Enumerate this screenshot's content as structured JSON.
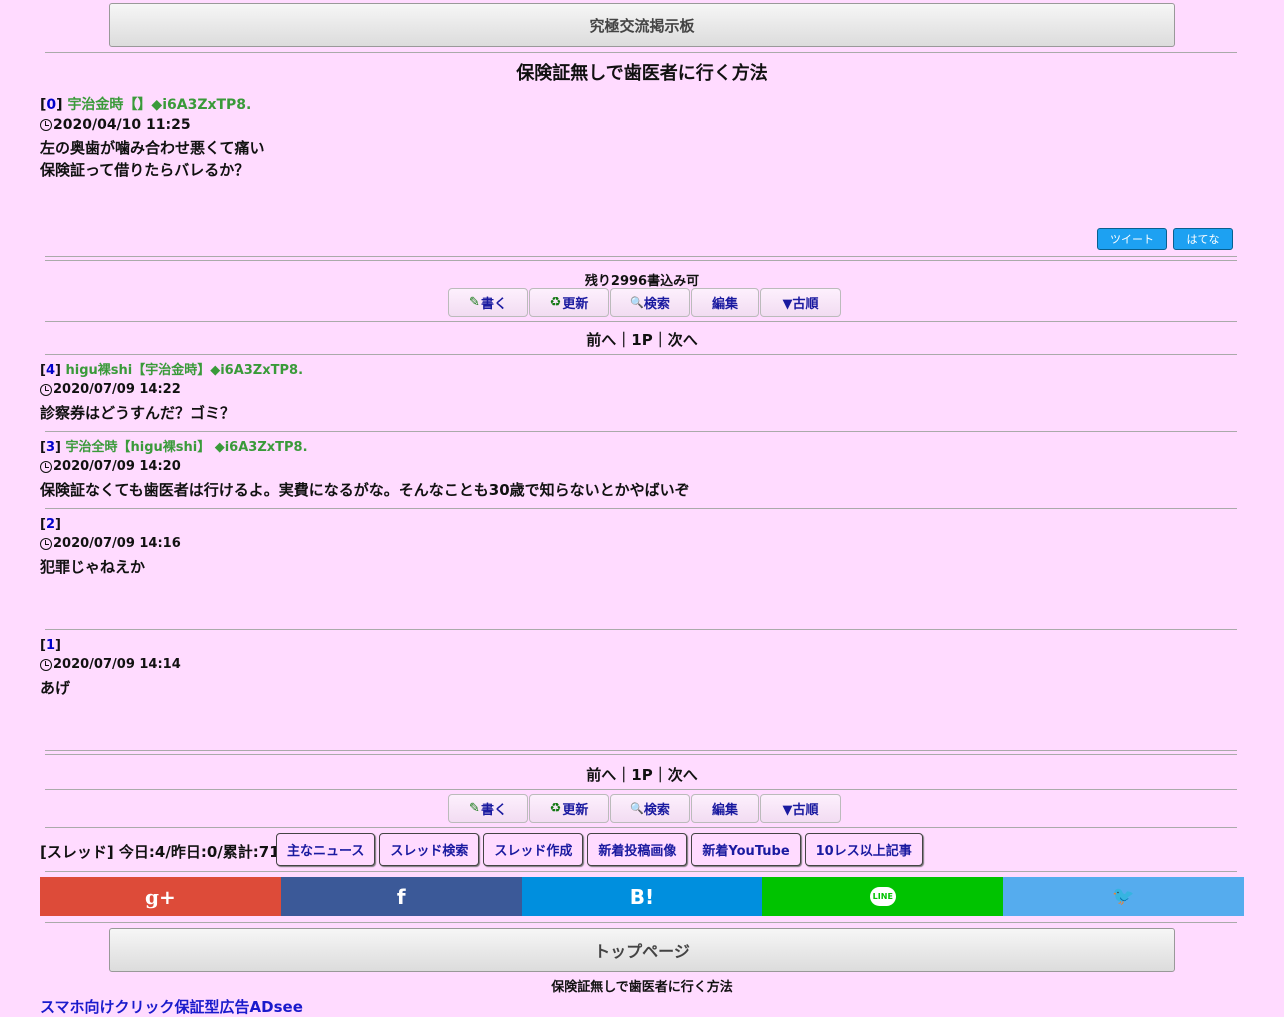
{
  "board_title": "究極交流掲示板",
  "thread_title": "保険証無しで歯医者に行く方法",
  "op": {
    "num": "0",
    "author": "宇治金時【】◆i6A3ZxTP8.",
    "date": "2020/04/10 11:25",
    "line1": "左の奥歯が噛み合わせ悪くて痛い",
    "line2": "保険証って借りたらバレるか？"
  },
  "share": {
    "tweet": "ツイート",
    "hatena": "はてな"
  },
  "remaining": "残り2996書込み可",
  "toolbar": {
    "write": "書く",
    "refresh": "更新",
    "search": "検索",
    "edit": "編集",
    "order": "▼古順"
  },
  "toolbar_icons": {
    "write": "✎",
    "refresh": "♻",
    "search": "🔍"
  },
  "pager": {
    "prev": "前へ",
    "sep1": "｜",
    "page": "1P",
    "sep2": "｜",
    "next": "次へ"
  },
  "posts": [
    {
      "num": "4",
      "author": "higu裸shi【宇治金時】◆i6A3ZxTP8.",
      "date": "2020/07/09 14:22",
      "body": "診察券はどうすんだ？ゴミ？"
    },
    {
      "num": "3",
      "author": "宇治全時【higu裸shi】 ◆i6A3ZxTP8.",
      "date": "2020/07/09 14:20",
      "body": "保険証なくても歯医者は行けるよ。実費になるがな。そんなことも30歳で知らないとかやばいぞ"
    },
    {
      "num": "2",
      "author": "",
      "date": "2020/07/09 14:16",
      "body": "犯罪じゃねえか"
    },
    {
      "num": "1",
      "author": "",
      "date": "2020/07/09 14:14",
      "body": "あげ"
    }
  ],
  "stats": "[スレッド] 今日:4/昨日:0/累計:71",
  "links": [
    "主なニュース",
    "スレッド検索",
    "スレッド作成",
    "新着投稿画像",
    "新着YouTube",
    "10レス以上記事"
  ],
  "social": {
    "google_plus": "g+",
    "facebook": "f",
    "hatena": "B!",
    "line": "LINE",
    "twitter": "🐦",
    "colors": {
      "google_plus": "#dd4b39",
      "facebook": "#3b5998",
      "hatena": "#008fde",
      "line": "#00c300",
      "twitter": "#55acee"
    }
  },
  "top_page": "トップページ",
  "footer_title": "保険証無しで歯医者に行く方法",
  "ad_link": "スマホ向けクリック保証型広告ADsee"
}
